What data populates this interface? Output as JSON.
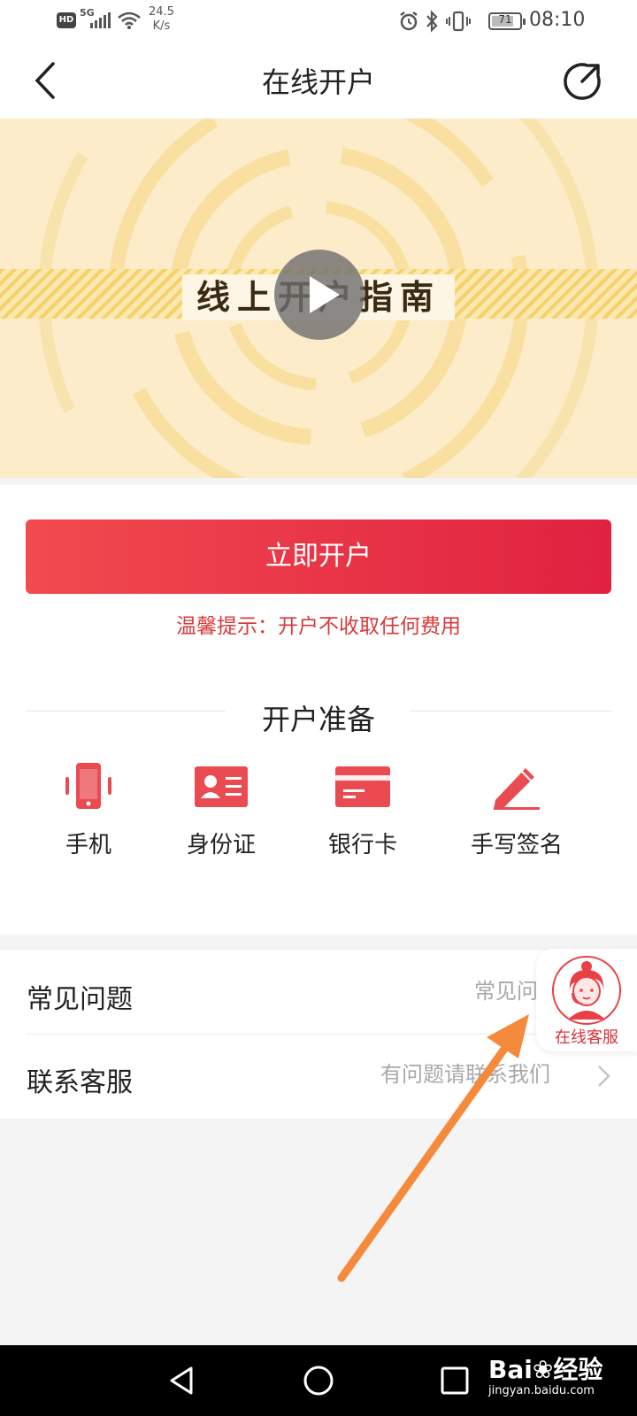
{
  "status_bar": {
    "hd_label": "HD",
    "net_type": "5G",
    "speed_value": "24.5",
    "speed_unit": "K/s",
    "battery": "71",
    "time": "08:10"
  },
  "nav": {
    "title": "在线开户"
  },
  "banner": {
    "label": "线上开户指南"
  },
  "main": {
    "open_button": "立即开户",
    "tip": "温馨提示：开户不收取任何费用",
    "section_title": "开户准备",
    "prep_items": [
      {
        "label": "手机",
        "icon": "phone-icon"
      },
      {
        "label": "身份证",
        "icon": "id-card-icon"
      },
      {
        "label": "银行卡",
        "icon": "bank-card-icon"
      },
      {
        "label": "手写签名",
        "icon": "pen-icon"
      }
    ]
  },
  "list": {
    "rows": [
      {
        "title": "常见问题",
        "hint": "常见问"
      },
      {
        "title": "联系客服",
        "hint": "有问题请联系我们"
      }
    ]
  },
  "float_service": {
    "label": "在线客服"
  },
  "watermark": {
    "brand": "Bai",
    "brand2": "经验",
    "url": "jingyan.baidu.com"
  },
  "colors": {
    "accent": "#e02240",
    "tip": "#d83a3a",
    "icon": "#ea4b50",
    "annotation": "#f58a3c"
  }
}
